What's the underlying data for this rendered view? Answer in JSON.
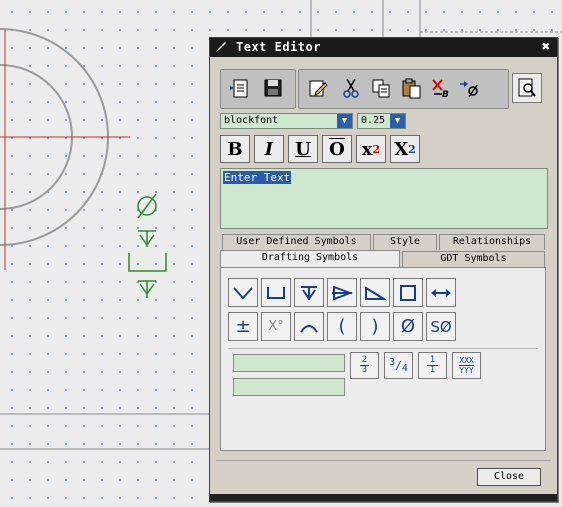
{
  "dialog": {
    "title": "Text Editor",
    "close_glyph": "✖"
  },
  "toolbar": {
    "buttons": [
      "new-document-icon",
      "save-icon",
      "edit-text-icon",
      "cut-icon",
      "copy-icon",
      "paste-icon",
      "clear-format-icon",
      "insert-symbol-icon",
      "preview-icon"
    ]
  },
  "font": {
    "family_value": "blockfont",
    "size_value": "0.25"
  },
  "format_buttons": {
    "bold": "B",
    "italic": "I",
    "underline": "U",
    "overline": "O",
    "superscript": "x",
    "superscript_sub": "2",
    "subscript": "X",
    "subscript_sub": "2"
  },
  "editor": {
    "text": "Enter Text"
  },
  "tabs": {
    "row1": [
      "User Defined Symbols",
      "Style",
      "Relationships"
    ],
    "row2": [
      "Drafting Symbols",
      "GDT Symbols"
    ],
    "active": "Drafting Symbols"
  },
  "symbols": {
    "row1": [
      "countersink-icon",
      "counterbore-icon",
      "depth-icon",
      "conical-taper-icon",
      "slope-icon",
      "square-icon",
      "arc-length-both-icon"
    ],
    "row2": [
      "±",
      "X°",
      "arc-icon",
      "(",
      ")",
      "Ø",
      "SØ"
    ]
  },
  "fractions": {
    "frac1": {
      "num": "2",
      "den": "3"
    },
    "frac2": {
      "num": "3",
      "den": "4"
    },
    "frac3": {
      "num": "1",
      "den": "1"
    },
    "frac4": {
      "num": "XXX",
      "den": "YYY"
    }
  },
  "footer": {
    "close_label": "Close"
  },
  "colors": {
    "title_bar": "#1b1b1b",
    "field_fill": "#cfe6cf",
    "selection": "#2a5ca8",
    "symbol_blue": "#1a3d8f",
    "cad_green": "#2e8b2e",
    "cad_red": "#c03030"
  }
}
